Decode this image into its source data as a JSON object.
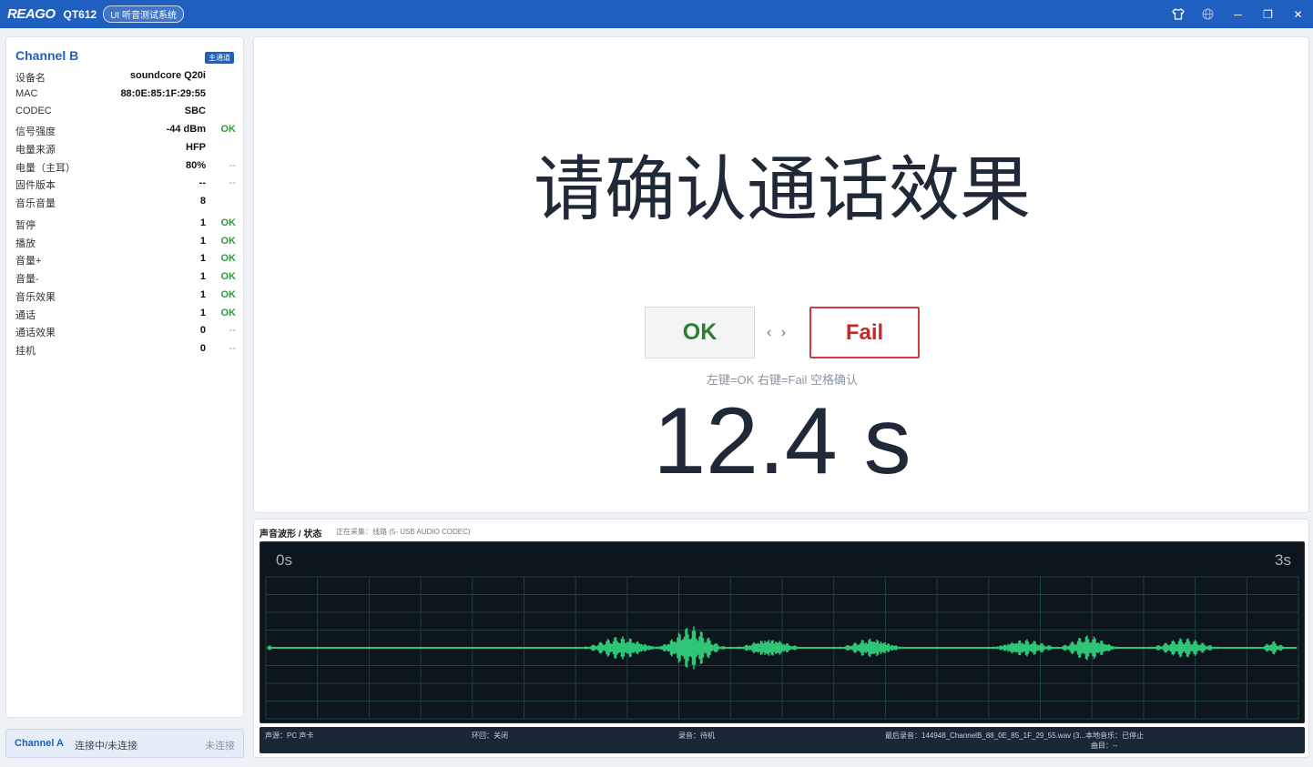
{
  "titlebar": {
    "brand": "REAGO",
    "model": "QT612",
    "system": "UI 听音测试系统",
    "icons": [
      "shirt-icon",
      "globe-icon",
      "minimize-icon",
      "restore-icon",
      "close-icon"
    ],
    "glyphs": {
      "minimize": "─",
      "restore": "❐",
      "close": "✕"
    }
  },
  "left_panel": {
    "channel": "Channel B",
    "badge": "主通道",
    "info": [
      {
        "key": "设备名",
        "value": "soundcore Q20i",
        "status": ""
      },
      {
        "key": "MAC",
        "value": "88:0E:85:1F:29:55",
        "status": ""
      },
      {
        "key": "CODEC",
        "value": "SBC",
        "status": ""
      },
      {
        "key": "信号强度",
        "value": "-44 dBm",
        "status": "OK"
      },
      {
        "key": "电量来源",
        "value": "HFP",
        "status": ""
      },
      {
        "key": "电量（主耳）",
        "value": "80%",
        "status": "--"
      },
      {
        "key": "固件版本",
        "value": "--",
        "status": "--"
      },
      {
        "key": "音乐音量",
        "value": "8",
        "status": ""
      }
    ],
    "tests": [
      {
        "key": "暂停",
        "value": "1",
        "status": "OK"
      },
      {
        "key": "播放",
        "value": "1",
        "status": "OK"
      },
      {
        "key": "音量+",
        "value": "1",
        "status": "OK"
      },
      {
        "key": "音量-",
        "value": "1",
        "status": "OK"
      },
      {
        "key": "音乐效果",
        "value": "1",
        "status": "OK"
      },
      {
        "key": "通话",
        "value": "1",
        "status": "OK"
      },
      {
        "key": "通话效果",
        "value": "0",
        "status": "--"
      },
      {
        "key": "挂机",
        "value": "0",
        "status": "--"
      }
    ]
  },
  "channel_a": {
    "name": "Channel A",
    "state": "连接中/未连接",
    "connection": "未连接"
  },
  "main": {
    "prompt": "请确认通话效果",
    "ok_label": "OK",
    "arrows": "‹ ›",
    "fail_label": "Fail",
    "hint": "左键=OK  右键=Fail  空格确认",
    "timer": "12.4 s"
  },
  "waveform": {
    "title": "声音波形 / 状态",
    "subtitle": "正在采集：线路 (5- USB AUDIO  CODEC)",
    "start_label": "0s",
    "end_label": "3s",
    "wave_color": "#2fc476",
    "grid_color": "#20403a",
    "status": {
      "source": "声源：PC 声卡",
      "loop": "环回：关闭",
      "record": "录音：待机",
      "last": "最后录音：144948_ChannelB_88_0E_85_1F_29_55.wav (3...本地音乐：已停止",
      "track": "曲目：--"
    }
  }
}
